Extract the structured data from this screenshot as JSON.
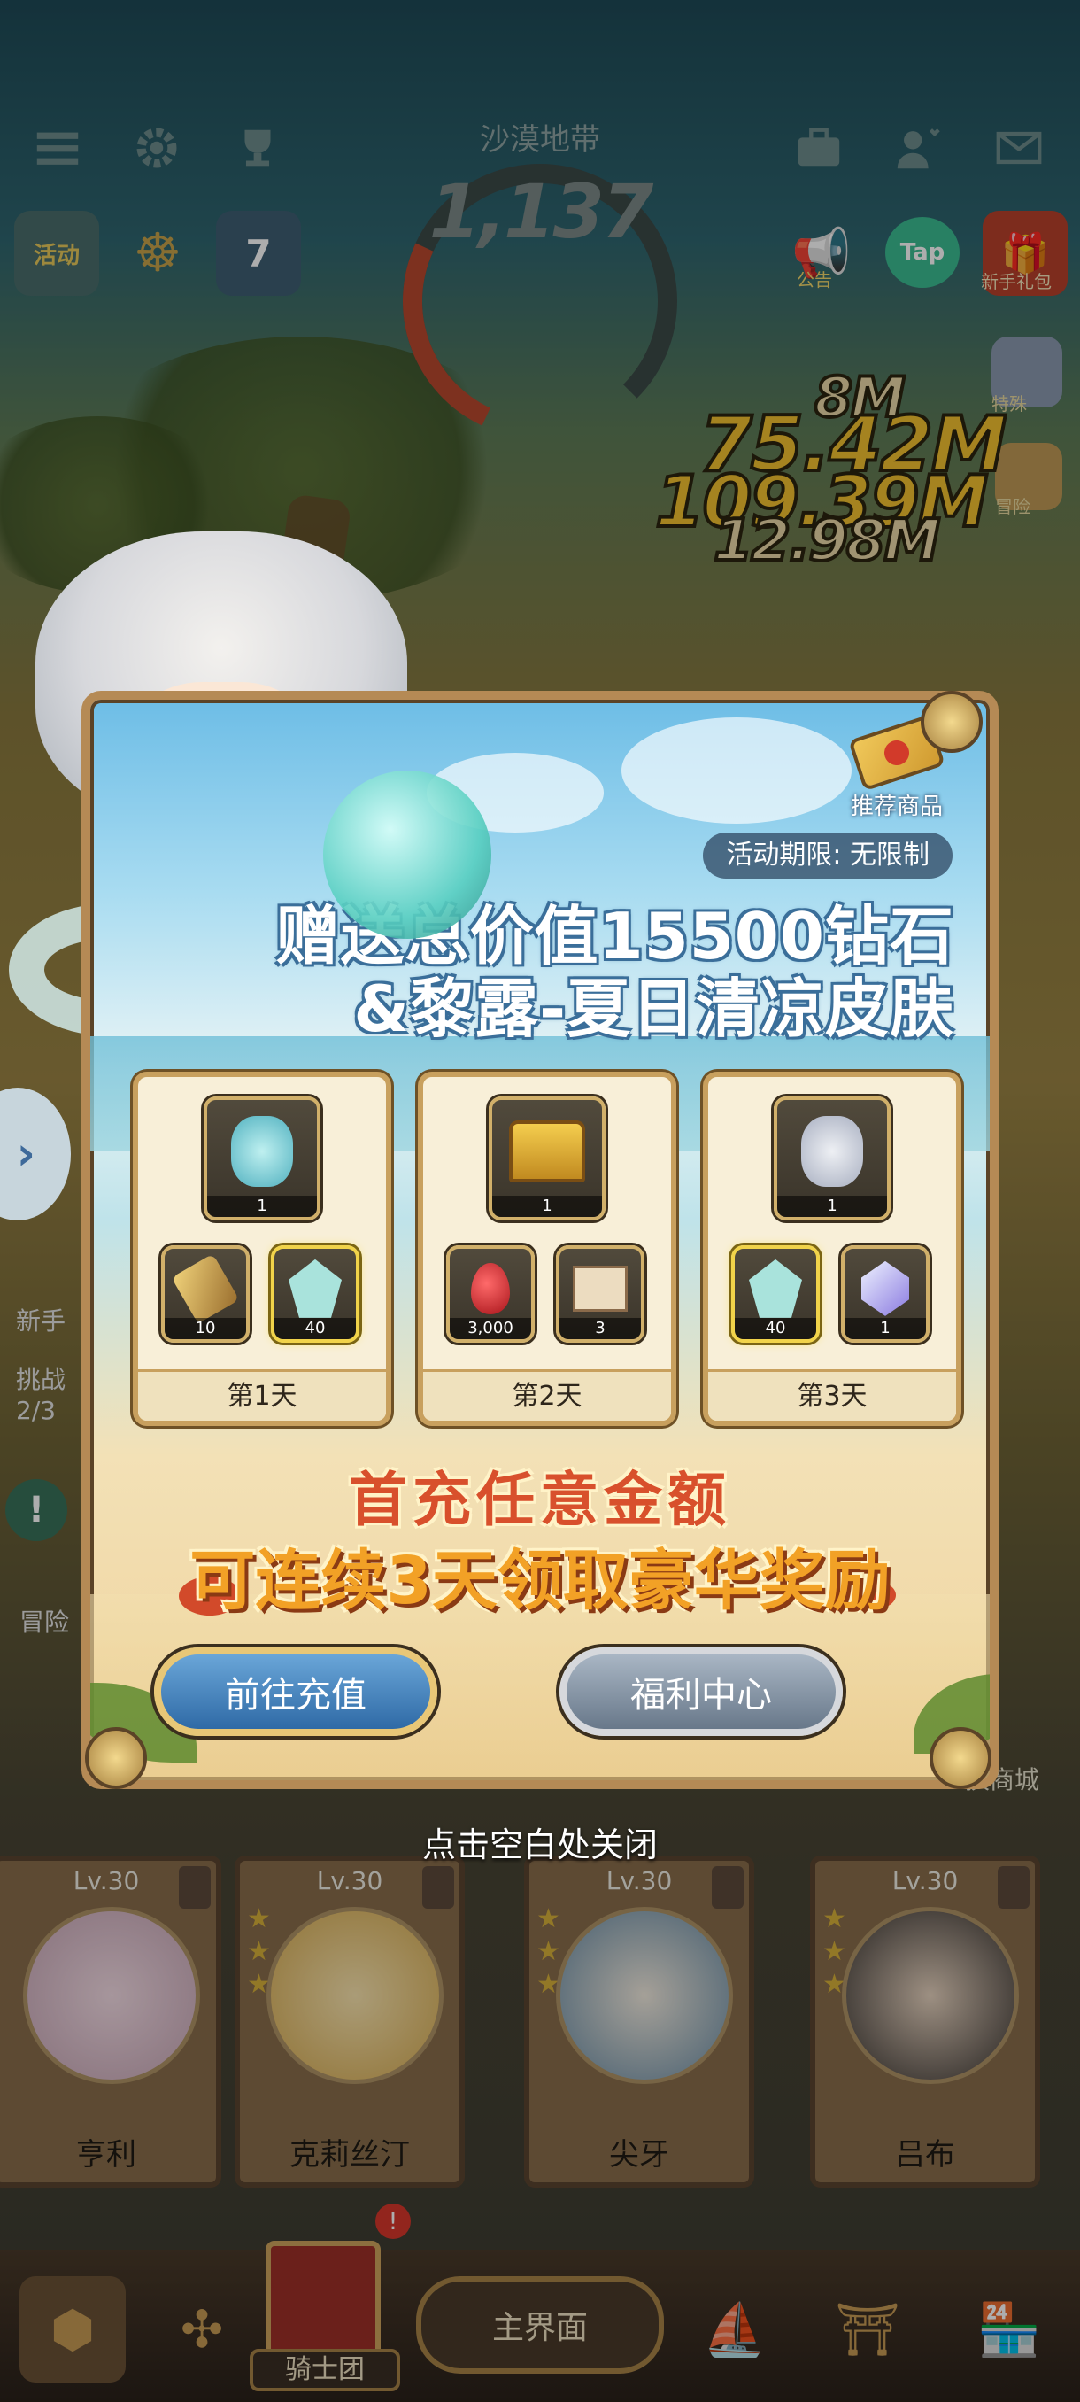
{
  "hud": {
    "zone_name": "沙漠地带",
    "zone_count": "1,137",
    "calendar_day": "7",
    "activity_label": "活动",
    "notice_label": "公告",
    "tap_label": "Tap",
    "newbie_gift_label": "新手礼包",
    "special_label": "特殊",
    "adventure_label": "冒险",
    "newbie_label": "新手",
    "challenge_label": "挑战",
    "challenge_progress": "2/3",
    "adv_label2": "冒险",
    "exchange_shop_label": "换商城"
  },
  "damage_numbers": [
    "8M",
    "75.42M",
    "109.39M",
    "12.98M"
  ],
  "popup": {
    "recommended_label": "推荐商品",
    "period_text": "活动期限: 无限制",
    "headline_line1": "赠送总价值15500钻石",
    "headline_line2": "&黎露-夏日清凉皮肤",
    "days": [
      {
        "label": "第1天",
        "items": [
          {
            "icon": "character-skin-icon",
            "qty": "1"
          },
          {
            "icon": "scroll-icon",
            "qty": "10"
          },
          {
            "icon": "hero-shard-icon",
            "qty": "40"
          }
        ]
      },
      {
        "label": "第2天",
        "items": [
          {
            "icon": "treasure-chest-icon",
            "qty": "1"
          },
          {
            "icon": "red-gem-icon",
            "qty": "3,000"
          },
          {
            "icon": "map-icon",
            "qty": "3"
          }
        ]
      },
      {
        "label": "第3天",
        "items": [
          {
            "icon": "character-skin-icon",
            "qty": "1"
          },
          {
            "icon": "hero-shard-icon",
            "qty": "40"
          },
          {
            "icon": "diamond-icon",
            "qty": "1"
          }
        ]
      }
    ],
    "promo_line1": "首充任意金额",
    "promo_line2": "可连续3天领取豪华奖励",
    "recharge_button": "前往充值",
    "welfare_button": "福利中心"
  },
  "close_hint": "点击空白处关闭",
  "heroes": [
    {
      "level": "Lv.30",
      "name": "亨利"
    },
    {
      "level": "Lv.30",
      "name": "克莉丝汀"
    },
    {
      "level": "Lv.30",
      "name": "尖牙"
    },
    {
      "level": "Lv.30",
      "name": "吕布"
    }
  ],
  "nav": {
    "knights_label": "骑士团",
    "home_label": "主界面"
  },
  "colors": {
    "popup_border": "#b58a55",
    "promo_red": "#d8502c",
    "promo_orange": "#f2a126",
    "recharge_blue": "#2f6aa6"
  }
}
